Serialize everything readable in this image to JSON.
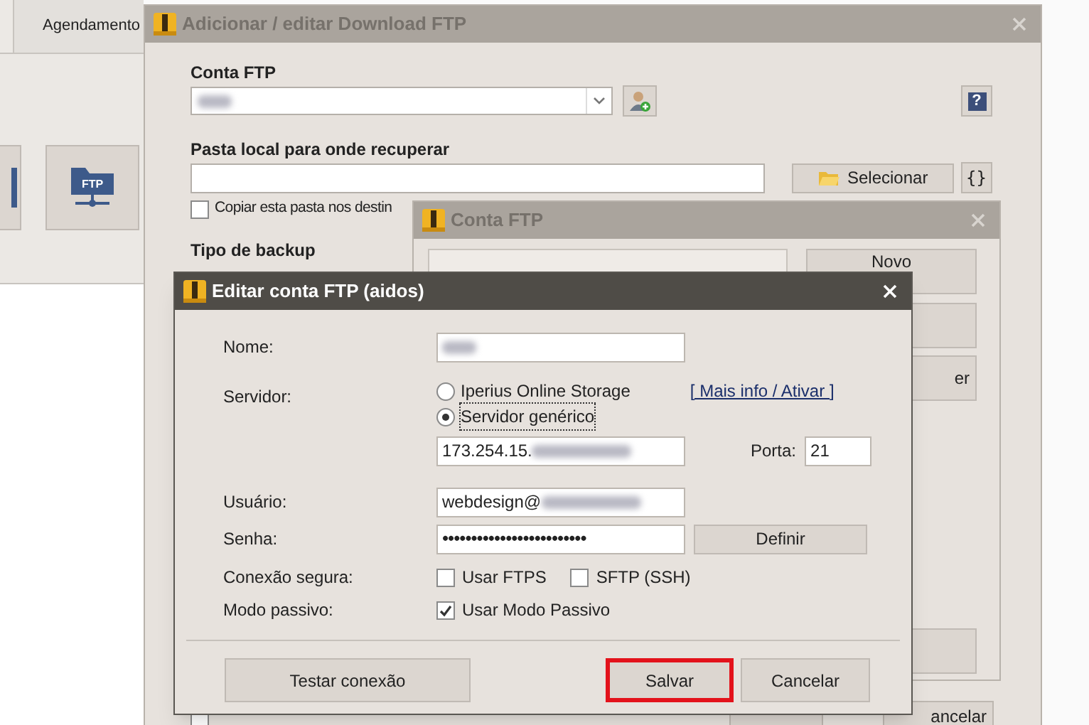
{
  "background_app": {
    "tabs": [
      {
        "label": "Agendamento",
        "selected": false
      }
    ],
    "toolbar_label": "FTP"
  },
  "download_window": {
    "title": "Adicionar / editar Download FTP",
    "active": false,
    "ftp_account_label": "Conta FTP",
    "ftp_account": {
      "redacted": true
    },
    "help_button": "?",
    "local_folder_label": "Pasta local para onde recuperar",
    "select_button": "Selecionar",
    "variables_button": "{}",
    "copy_checkbox": {
      "label": "Copiar esta pasta nos destin",
      "checked": false
    },
    "backup_type_label": "Tipo de backup",
    "bottom_checkbox": {
      "checked": false
    },
    "bottom_buttons": [
      "ancelar"
    ]
  },
  "accounts_window": {
    "title": "Conta FTP",
    "active": false,
    "buttons": [
      "Novo",
      "er"
    ]
  },
  "edit_dialog": {
    "title": "Editar conta FTP (aidos)",
    "active": true,
    "name": {
      "label": "Nome:",
      "redacted": true
    },
    "server_label": "Servidor:",
    "server_options": [
      {
        "label": "Iperius Online Storage",
        "selected": false
      },
      {
        "label": "Servidor genérico",
        "selected": true
      }
    ],
    "info_link": "[ Mais info / Ativar ]",
    "host": {
      "value": "173.254.15.",
      "redacted": true
    },
    "port": {
      "label": "Porta:",
      "value": "21"
    },
    "user": {
      "label": "Usuário:",
      "value": "webdesign@",
      "redacted": true
    },
    "password": {
      "label": "Senha:",
      "value": "•••••••••••••••••••••••••"
    },
    "define_button": "Definir",
    "secure_label": "Conexão segura:",
    "secure_options": [
      {
        "label": "Usar FTPS",
        "checked": false
      },
      {
        "label": "SFTP (SSH)",
        "checked": false
      }
    ],
    "passive_label": "Modo passivo:",
    "passive_option": {
      "label": "Usar Modo Passivo",
      "checked": true
    },
    "buttons": [
      {
        "label": "Testar conexão",
        "highlighted": false
      },
      {
        "label": "Salvar",
        "highlighted": true
      },
      {
        "label": "Cancelar",
        "highlighted": false
      }
    ]
  }
}
